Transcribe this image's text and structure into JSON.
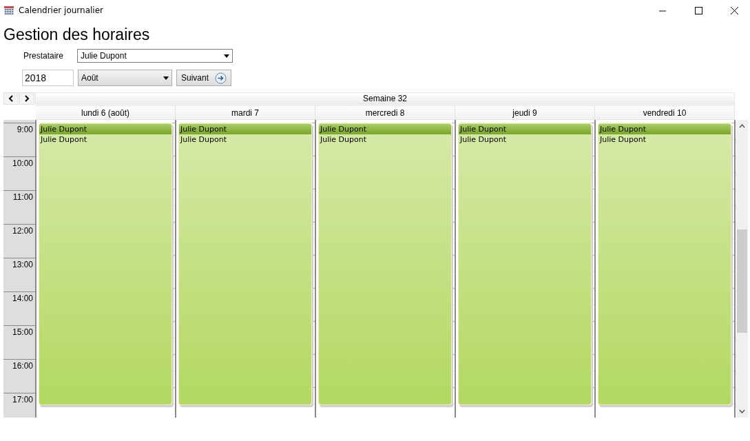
{
  "window": {
    "title": "Calendrier journalier"
  },
  "heading": "Gestion des horaires",
  "provider": {
    "label": "Prestataire",
    "value": "Julie Dupont"
  },
  "year": {
    "value": "2018"
  },
  "month": {
    "value": "Août"
  },
  "next_button": {
    "label": "Suivant"
  },
  "week_title": "Semaine 32",
  "hours": [
    "9:00",
    "10:00",
    "11:00",
    "12:00",
    "13:00",
    "14:00",
    "15:00",
    "16:00",
    "17:00"
  ],
  "days": [
    {
      "label": "lundi 6 (août)",
      "events": [
        {
          "title": "Julie Dupont",
          "subtitle": "Julie Dupont"
        }
      ]
    },
    {
      "label": "mardi 7",
      "events": [
        {
          "title": "Julie Dupont",
          "subtitle": "Julie Dupont"
        }
      ]
    },
    {
      "label": "mercredi 8",
      "events": [
        {
          "title": "Julie Dupont",
          "subtitle": "Julie Dupont"
        }
      ]
    },
    {
      "label": "jeudi 9",
      "events": [
        {
          "title": "Julie Dupont",
          "subtitle": "Julie Dupont"
        }
      ]
    },
    {
      "label": "vendredi 10",
      "events": [
        {
          "title": "Julie Dupont",
          "subtitle": "Julie Dupont"
        }
      ]
    }
  ]
}
